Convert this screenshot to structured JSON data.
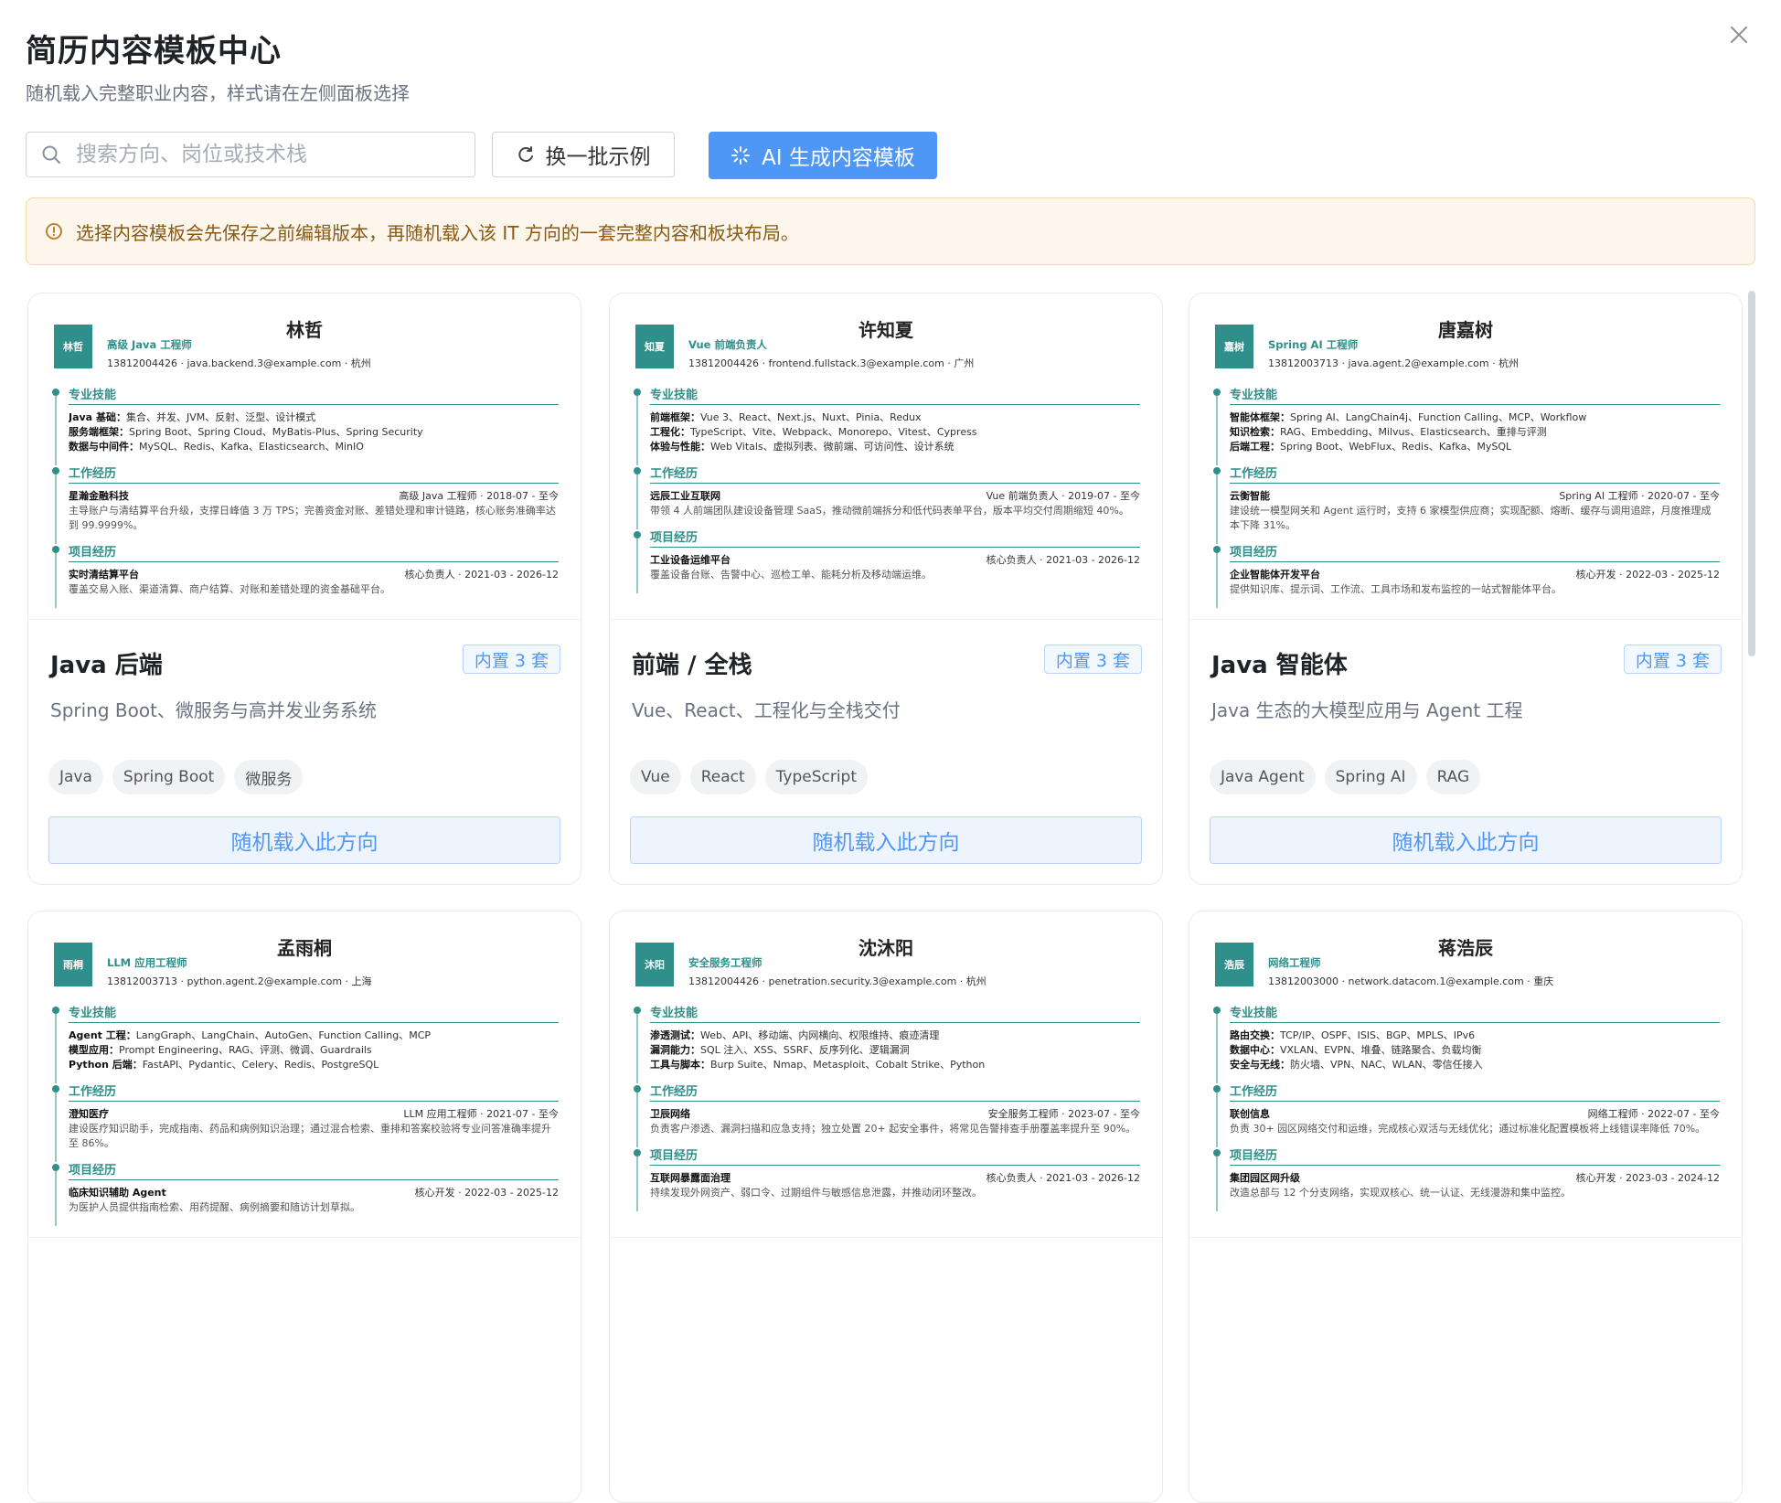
{
  "header": {
    "title": "简历内容模板中心",
    "subtitle": "随机载入完整职业内容，样式请在左侧面板选择"
  },
  "toolbar": {
    "search_placeholder": "搜索方向、岗位或技术栈",
    "refresh_label": "换一批示例",
    "ai_label": "AI 生成内容模板"
  },
  "notice": {
    "text": "选择内容模板会先保存之前编辑版本，再随机载入该 IT 方向的一套完整内容和板块布局。"
  },
  "colors": {
    "accent": "#4f97f7",
    "teal": "#2f8f8b",
    "notice_bg": "#fdf6ec"
  },
  "cards": [
    {
      "preview": {
        "avatar": "林哲",
        "name": "林哲",
        "role": "高级 Java 工程师",
        "contact": "13812004426 · java.backend.3@example.com · 杭州",
        "skills_title": "专业技能",
        "skills": [
          {
            "label": "Java 基础：",
            "value": "集合、并发、JVM、反射、泛型、设计模式"
          },
          {
            "label": "服务端框架：",
            "value": "Spring Boot、Spring Cloud、MyBatis-Plus、Spring Security"
          },
          {
            "label": "数据与中间件：",
            "value": "MySQL、Redis、Kafka、Elasticsearch、MinIO"
          }
        ],
        "work_title": "工作经历",
        "work": {
          "company": "星瀚金融科技",
          "meta": "高级 Java 工程师 · 2018-07 - 至今",
          "desc": "主导账户与清结算平台升级，支撑日峰值 3 万 TPS；完善资金对账、差错处理和审计链路，核心账务准确率达到 99.9999%。"
        },
        "project_title": "项目经历",
        "project": {
          "name": "实时清结算平台",
          "meta": "核心负责人 · 2021-03 - 2026-12",
          "desc": "覆盖交易入账、渠道清算、商户结算、对账和差错处理的资金基础平台。"
        }
      },
      "title": "Java 后端",
      "badge": "内置 3 套",
      "desc": "Spring Boot、微服务与高并发业务系统",
      "tags": [
        "Java",
        "Spring Boot",
        "微服务"
      ],
      "button": "随机载入此方向"
    },
    {
      "preview": {
        "avatar": "知夏",
        "name": "许知夏",
        "role": "Vue 前端负责人",
        "contact": "13812004426 · frontend.fullstack.3@example.com · 广州",
        "skills_title": "专业技能",
        "skills": [
          {
            "label": "前端框架：",
            "value": "Vue 3、React、Next.js、Nuxt、Pinia、Redux"
          },
          {
            "label": "工程化：",
            "value": "TypeScript、Vite、Webpack、Monorepo、Vitest、Cypress"
          },
          {
            "label": "体验与性能：",
            "value": "Web Vitals、虚拟列表、微前端、可访问性、设计系统"
          }
        ],
        "work_title": "工作经历",
        "work": {
          "company": "远辰工业互联网",
          "meta": "Vue 前端负责人 · 2019-07 - 至今",
          "desc": "带领 4 人前端团队建设设备管理 SaaS，推动微前端拆分和低代码表单平台，版本平均交付周期缩短 40%。"
        },
        "project_title": "项目经历",
        "project": {
          "name": "工业设备运维平台",
          "meta": "核心负责人 · 2021-03 - 2026-12",
          "desc": "覆盖设备台账、告警中心、巡检工单、能耗分析及移动端运维。"
        }
      },
      "title": "前端 / 全栈",
      "badge": "内置 3 套",
      "desc": "Vue、React、工程化与全栈交付",
      "tags": [
        "Vue",
        "React",
        "TypeScript"
      ],
      "button": "随机载入此方向"
    },
    {
      "preview": {
        "avatar": "嘉树",
        "name": "唐嘉树",
        "role": "Spring AI 工程师",
        "contact": "13812003713 · java.agent.2@example.com · 杭州",
        "skills_title": "专业技能",
        "skills": [
          {
            "label": "智能体框架：",
            "value": "Spring AI、LangChain4j、Function Calling、MCP、Workflow"
          },
          {
            "label": "知识检索：",
            "value": "RAG、Embedding、Milvus、Elasticsearch、重排与评测"
          },
          {
            "label": "后端工程：",
            "value": "Spring Boot、WebFlux、Redis、Kafka、MySQL"
          }
        ],
        "work_title": "工作经历",
        "work": {
          "company": "云衡智能",
          "meta": "Spring AI 工程师 · 2020-07 - 至今",
          "desc": "建设统一模型网关和 Agent 运行时，支持 6 家模型供应商；实现配额、熔断、缓存与调用追踪，月度推理成本下降 31%。"
        },
        "project_title": "项目经历",
        "project": {
          "name": "企业智能体开发平台",
          "meta": "核心开发 · 2022-03 - 2025-12",
          "desc": "提供知识库、提示词、工作流、工具市场和发布监控的一站式智能体平台。"
        }
      },
      "title": "Java 智能体",
      "badge": "内置 3 套",
      "desc": "Java 生态的大模型应用与 Agent 工程",
      "tags": [
        "Java Agent",
        "Spring AI",
        "RAG"
      ],
      "button": "随机载入此方向"
    },
    {
      "preview": {
        "avatar": "雨桐",
        "name": "孟雨桐",
        "role": "LLM 应用工程师",
        "contact": "13812003713 · python.agent.2@example.com · 上海",
        "skills_title": "专业技能",
        "skills": [
          {
            "label": "Agent 工程：",
            "value": "LangGraph、LangChain、AutoGen、Function Calling、MCP"
          },
          {
            "label": "模型应用：",
            "value": "Prompt Engineering、RAG、评测、微调、Guardrails"
          },
          {
            "label": "Python 后端：",
            "value": "FastAPI、Pydantic、Celery、Redis、PostgreSQL"
          }
        ],
        "work_title": "工作经历",
        "work": {
          "company": "澄知医疗",
          "meta": "LLM 应用工程师 · 2021-07 - 至今",
          "desc": "建设医疗知识助手，完成指南、药品和病例知识治理；通过混合检索、重排和答案校验将专业问答准确率提升至 86%。"
        },
        "project_title": "项目经历",
        "project": {
          "name": "临床知识辅助 Agent",
          "meta": "核心开发 · 2022-03 - 2025-12",
          "desc": "为医护人员提供指南检索、用药提醒、病例摘要和随访计划草拟。"
        }
      }
    },
    {
      "preview": {
        "avatar": "沐阳",
        "name": "沈沐阳",
        "role": "安全服务工程师",
        "contact": "13812004426 · penetration.security.3@example.com · 杭州",
        "skills_title": "专业技能",
        "skills": [
          {
            "label": "渗透测试：",
            "value": "Web、API、移动端、内网横向、权限维持、痕迹清理"
          },
          {
            "label": "漏洞能力：",
            "value": "SQL 注入、XSS、SSRF、反序列化、逻辑漏洞"
          },
          {
            "label": "工具与脚本：",
            "value": "Burp Suite、Nmap、Metasploit、Cobalt Strike、Python"
          }
        ],
        "work_title": "工作经历",
        "work": {
          "company": "卫辰网络",
          "meta": "安全服务工程师 · 2023-07 - 至今",
          "desc": "负责客户渗透、漏洞扫描和应急支持；独立处置 20+ 起安全事件，将常见告警排查手册覆盖率提升至 90%。"
        },
        "project_title": "项目经历",
        "project": {
          "name": "互联网暴露面治理",
          "meta": "核心负责人 · 2021-03 - 2026-12",
          "desc": "持续发现外网资产、弱口令、过期组件与敏感信息泄露，并推动闭环整改。"
        }
      }
    },
    {
      "preview": {
        "avatar": "浩辰",
        "name": "蒋浩辰",
        "role": "网络工程师",
        "contact": "13812003000 · network.datacom.1@example.com · 重庆",
        "skills_title": "专业技能",
        "skills": [
          {
            "label": "路由交换：",
            "value": "TCP/IP、OSPF、ISIS、BGP、MPLS、IPv6"
          },
          {
            "label": "数据中心：",
            "value": "VXLAN、EVPN、堆叠、链路聚合、负载均衡"
          },
          {
            "label": "安全与无线：",
            "value": "防火墙、VPN、NAC、WLAN、零信任接入"
          }
        ],
        "work_title": "工作经历",
        "work": {
          "company": "联创信息",
          "meta": "网络工程师 · 2022-07 - 至今",
          "desc": "负责 30+ 园区网络交付和运维，完成核心双活与无线优化；通过标准化配置模板将上线错误率降低 70%。"
        },
        "project_title": "项目经历",
        "project": {
          "name": "集团园区网升级",
          "meta": "核心开发 · 2023-03 - 2024-12",
          "desc": "改造总部与 12 个分支网络，实现双核心、统一认证、无线漫游和集中监控。"
        }
      }
    }
  ]
}
